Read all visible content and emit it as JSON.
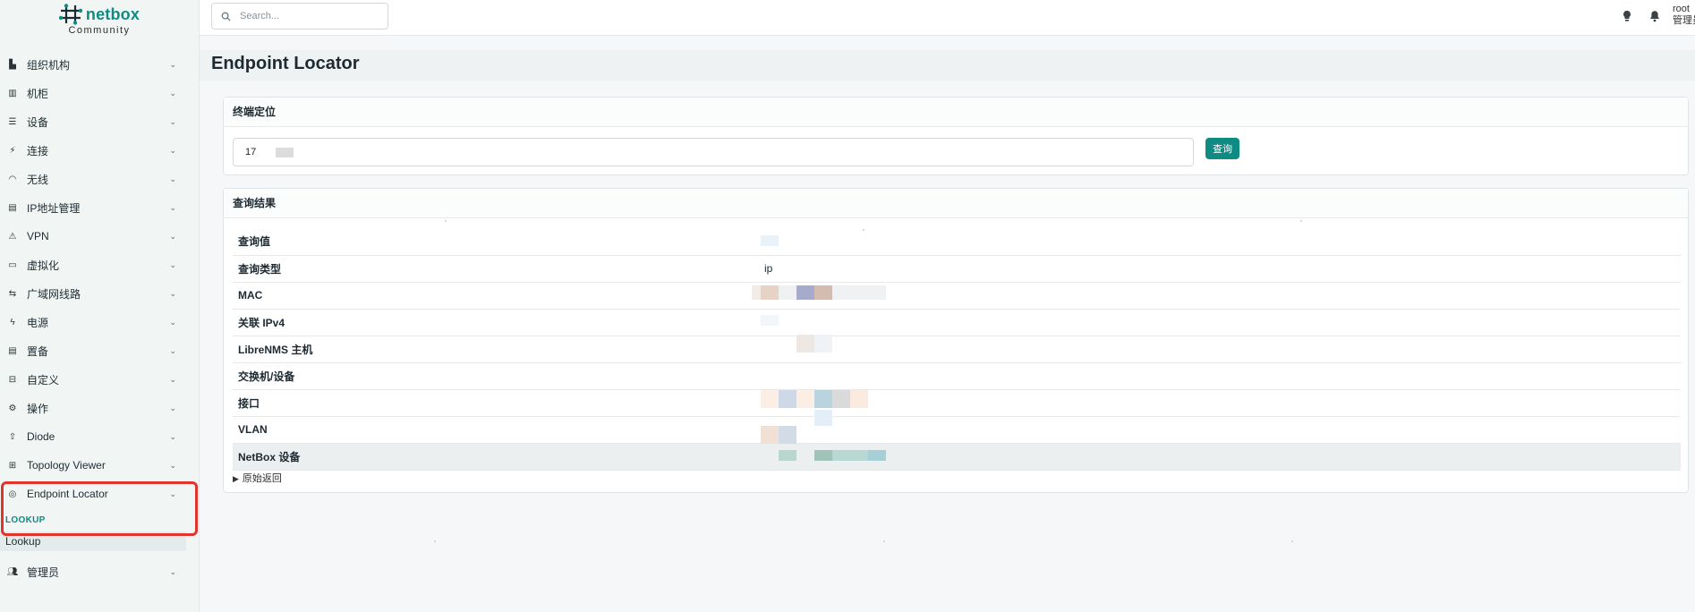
{
  "brand": {
    "name": "netbox",
    "subtitle": "Community"
  },
  "search": {
    "placeholder": "Search..."
  },
  "user": {
    "name": "root",
    "role": "管理员"
  },
  "nav": [
    {
      "label": "组织机构",
      "icon": "building-icon"
    },
    {
      "label": "机柜",
      "icon": "rack-icon"
    },
    {
      "label": "设备",
      "icon": "server-icon"
    },
    {
      "label": "连接",
      "icon": "plug-icon"
    },
    {
      "label": "无线",
      "icon": "wifi-icon"
    },
    {
      "label": "IP地址管理",
      "icon": "counter-icon"
    },
    {
      "label": "VPN",
      "icon": "tunnel-icon"
    },
    {
      "label": "虚拟化",
      "icon": "monitor-icon"
    },
    {
      "label": "广域网线路",
      "icon": "transit-icon"
    },
    {
      "label": "电源",
      "icon": "flash-icon"
    },
    {
      "label": "置备",
      "icon": "file-icon"
    },
    {
      "label": "自定义",
      "icon": "toolbox-icon"
    },
    {
      "label": "操作",
      "icon": "cogs-icon"
    },
    {
      "label": "Diode",
      "icon": "upload-icon"
    },
    {
      "label": "Topology Viewer",
      "icon": "topology-icon"
    },
    {
      "label": "Endpoint Locator",
      "icon": "locator-icon"
    }
  ],
  "nav_section": "LOOKUP",
  "nav_sub": "Lookup",
  "nav_admin": {
    "label": "管理员",
    "icon": "users-icon"
  },
  "page": {
    "title": "Endpoint Locator"
  },
  "lookup_card": {
    "header": "终端定位",
    "input_value": "17",
    "button": "查询"
  },
  "results_card": {
    "header": "查询结果",
    "rows": [
      {
        "key": "查询值",
        "value": ""
      },
      {
        "key": "查询类型",
        "value": "ip"
      },
      {
        "key": "MAC",
        "value": ""
      },
      {
        "key": "关联 IPv4",
        "value": ""
      },
      {
        "key": "LibreNMS 主机",
        "value": ""
      },
      {
        "key": "交换机/设备",
        "value": ""
      },
      {
        "key": "接口",
        "value": ""
      },
      {
        "key": "VLAN",
        "value": ""
      },
      {
        "key": "NetBox 设备",
        "value": ""
      }
    ],
    "raw_toggle": "原始返回"
  },
  "colors": {
    "accent": "#0f8b83",
    "highlight": "#e0342c"
  }
}
